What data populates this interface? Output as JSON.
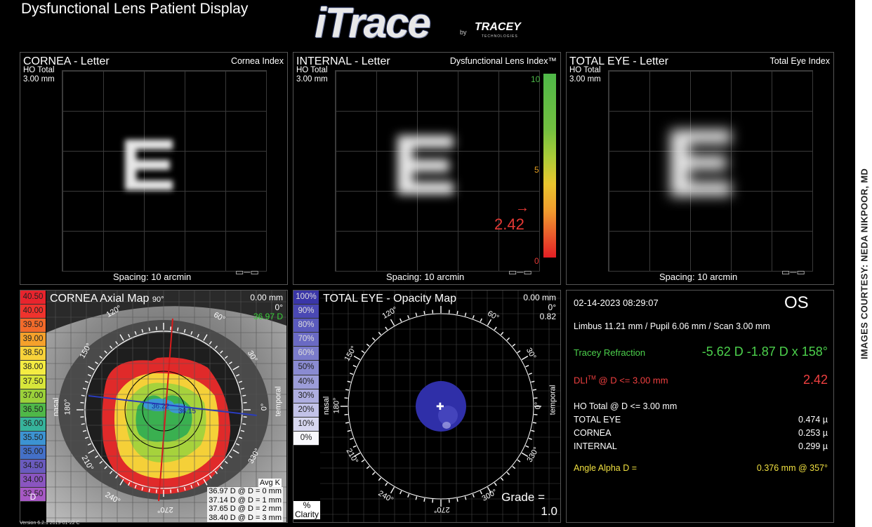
{
  "app_title": "Dysfunctional Lens Patient Display",
  "logo": {
    "brand": "iTrace",
    "by": "by",
    "company": "TRACEY",
    "company_sub": "TECHNOLOGIES"
  },
  "credit": "IMAGES COURTESY: NEDA NIKPOOR, MD",
  "version": "Version 6.2.1 2019-01-22 C",
  "letter_panels": [
    {
      "title": "CORNEA - Letter",
      "index_label": "Cornea Index",
      "sub1": "HO Total",
      "sub2": "3.00 mm",
      "spacing": "Spacing:  10 arcmin"
    },
    {
      "title": "INTERNAL - Letter",
      "index_label": "Dysfunctional Lens Index™",
      "sub1": "HO Total",
      "sub2": "3.00 mm",
      "spacing": "Spacing:  10 arcmin"
    },
    {
      "title": "TOTAL EYE - Letter",
      "index_label": "Total Eye Index",
      "sub1": "HO Total",
      "sub2": "3.00 mm",
      "spacing": "Spacing:  10 arcmin"
    }
  ],
  "dli_scale": {
    "ticks": [
      "10",
      "5",
      "0"
    ],
    "value": "2.42",
    "value_fraction": 0.242,
    "colors": [
      "#4fb848",
      "#e9c52e",
      "#e31e24"
    ]
  },
  "axial_map": {
    "title": "CORNEA  Axial Map",
    "top_angle": "90°",
    "offset": "0.00 mm",
    "offset_angle": "0°",
    "k_value": "36.97 D",
    "scale": [
      "40.50",
      "40.00",
      "39.50",
      "39.00",
      "38.50",
      "38.00",
      "37.50",
      "37.00",
      "36.50",
      "36.00",
      "35.50",
      "35.00",
      "34.50",
      "34.00",
      "33.50"
    ],
    "scale_colors": [
      "#e8242d",
      "#f0332d",
      "#f26a2a",
      "#f5a12b",
      "#f8d23a",
      "#f4ec42",
      "#d7e63a",
      "#9bd13a",
      "#4fb848",
      "#36b39b",
      "#3c93d2",
      "#4470c8",
      "#6a5bbe",
      "#8a55c0",
      "#a658c4"
    ],
    "unit": "D",
    "angles": {
      "a120": "120°",
      "a60": "60°",
      "a150": "150°",
      "a30": "30°",
      "nasal": "nasal",
      "a180": "180°",
      "temporal": "temporal",
      "a0": "0°",
      "a210": "210°",
      "a330": "330°",
      "a240": "240°",
      "a300": "300°",
      "a270": "270°"
    },
    "center_values": [
      "36.22",
      "36.15"
    ],
    "avg_k_label": "Avg K",
    "avg_k": [
      "36.97 D @ D = 0 mm",
      "37.14 D @ D = 1 mm",
      "37.65 D @ D = 2 mm",
      "38.40 D @ D = 3 mm"
    ]
  },
  "opacity_map": {
    "title": "TOTAL EYE - Opacity Map",
    "offset": "0.00 mm",
    "offset_angle": "0°",
    "value": "0.82",
    "scale": [
      "100%",
      "90%",
      "80%",
      "70%",
      "60%",
      "50%",
      "40%",
      "30%",
      "20%",
      "10%",
      "0%"
    ],
    "scale_colors": [
      "#3a36a8",
      "#4a48b4",
      "#5a5abd",
      "#6a6ac4",
      "#7a7bcb",
      "#8a8bd2",
      "#9c9dd9",
      "#aeaee0",
      "#c2c2e8",
      "#d8d8f0",
      "#f8f8fc"
    ],
    "scale_label1": "%",
    "scale_label2": "Clarity",
    "grade_label": "Grade =",
    "grade_value": "1.0",
    "angles": {
      "a120": "120°",
      "a60": "60°",
      "a150": "150°",
      "a30": "30°",
      "nasal": "nasal",
      "a180": "180°",
      "temporal": "temporal",
      "a0": "0°",
      "a210": "210°",
      "a330": "330°",
      "a240": "240°",
      "a300": "300°",
      "a270": "270°"
    }
  },
  "info": {
    "date": "02-14-2023  08:29:07",
    "eye": "OS",
    "measurements": "Limbus 11.21 mm  /  Pupil 6.06 mm  /  Scan 3.00 mm",
    "refraction_label": "Tracey Refraction",
    "refraction_value": "-5.62 D -1.87 D x 158°",
    "dli_label_a": "DLI",
    "dli_label_tm": "TM",
    "dli_label_b": " @ D <= 3.00 mm",
    "dli_value": "2.42",
    "ho_label": "HO Total @ D <= 3.00 mm",
    "rows": [
      {
        "label": "TOTAL EYE",
        "value": "0.474 µ"
      },
      {
        "label": "CORNEA",
        "value": "0.253 µ"
      },
      {
        "label": "INTERNAL",
        "value": "0.299 µ"
      }
    ],
    "alpha_label": "Angle Alpha  D =",
    "alpha_value": "0.376 mm @ 357°"
  }
}
